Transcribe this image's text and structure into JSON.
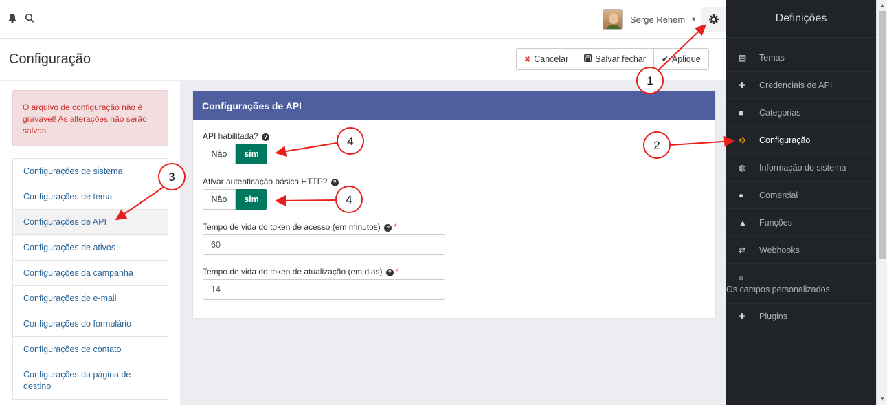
{
  "topbar": {
    "bell_icon": "bell-icon",
    "search_icon": "search-icon",
    "user_name": "Serge Rehem",
    "caret": "▼",
    "gear_icon": "gear-icon"
  },
  "header": {
    "title": "Configuração",
    "cancel_label": "Cancelar",
    "save_close_label": "Salvar fechar",
    "apply_label": "Aplique"
  },
  "alert": {
    "text": "O arquivo de configuração não é gravável! As alterações não serão salvas."
  },
  "menu": {
    "items": [
      {
        "label": "Configurações de sistema"
      },
      {
        "label": "Configurações de tema"
      },
      {
        "label": "Configurações de API"
      },
      {
        "label": "Configurações de ativos"
      },
      {
        "label": "Configurações da campanha"
      },
      {
        "label": "Configurações de e-mail"
      },
      {
        "label": "Configurações do formulário"
      },
      {
        "label": "Configurações de contato"
      },
      {
        "label": "Configurações da página de destino"
      }
    ]
  },
  "panel": {
    "title": "Configurações de API",
    "api_enabled_label": "API habilitada?",
    "http_auth_label": "Ativar autenticação básica HTTP?",
    "toggle_off": "Não",
    "toggle_on": "sim",
    "access_token_label": "Tempo de vida do token de acesso (em minutos)",
    "access_token_value": "60",
    "refresh_token_label": "Tempo de vida do token de atualização (em dias)",
    "refresh_token_value": "14",
    "required_mark": "*",
    "help_glyph": "?"
  },
  "sidebar": {
    "title": "Definições",
    "items": [
      {
        "label": "Temas",
        "icon": "newspaper-icon"
      },
      {
        "label": "Credenciais de API",
        "icon": "puzzle-icon"
      },
      {
        "label": "Categorias",
        "icon": "folder-icon"
      },
      {
        "label": "Configuração",
        "icon": "cogs-icon"
      },
      {
        "label": "Informação do sistema",
        "icon": "globe-icon"
      },
      {
        "label": "Comercial",
        "icon": "users-icon"
      },
      {
        "label": "Funções",
        "icon": "lock-icon"
      },
      {
        "label": "Webhooks",
        "icon": "exchange-icon"
      },
      {
        "label": "Os campos personalizados",
        "icon": "list-icon"
      },
      {
        "label": "Plugins",
        "icon": "plus-circle-icon"
      }
    ]
  },
  "annotations": {
    "colors": {
      "arrow": "#e8201c"
    },
    "callouts": [
      "1",
      "2",
      "3",
      "4",
      "4"
    ]
  },
  "colors": {
    "panel_header": "#4e5e9e",
    "toggle_on": "#00785f",
    "sidebar_bg": "#202428",
    "active_icon": "#f0a12c",
    "link": "#2a6496",
    "alert_text": "#c9302c"
  }
}
